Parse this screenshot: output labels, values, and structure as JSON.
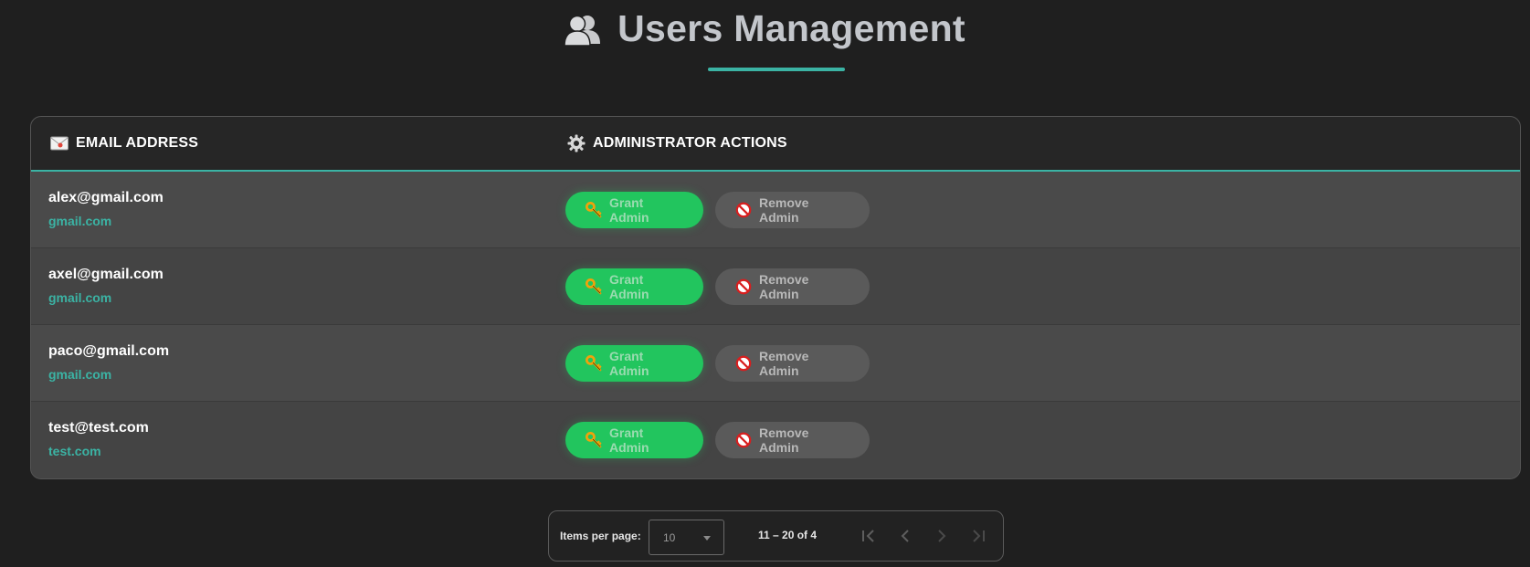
{
  "header": {
    "title": "Users Management",
    "icon": "users-icon",
    "accent": "#3bb3a4"
  },
  "table": {
    "columns": [
      {
        "label": "EMAIL ADDRESS",
        "icon": "envelope-icon"
      },
      {
        "label": "ADMINISTRATOR ACTIONS",
        "icon": "gear-icon"
      }
    ],
    "rows": [
      {
        "email": "alex@gmail.com",
        "domain": "gmail.com"
      },
      {
        "email": "axel@gmail.com",
        "domain": "gmail.com"
      },
      {
        "email": "paco@gmail.com",
        "domain": "gmail.com"
      },
      {
        "email": "test@test.com",
        "domain": "test.com"
      }
    ],
    "grant_label": "Grant Admin",
    "grant_icon": "key-icon",
    "remove_label": "Remove Admin",
    "remove_icon": "no-entry-icon",
    "grant_color": "#22c55e"
  },
  "paginator": {
    "items_per_page_label": "Items per page:",
    "items_per_page_value": "10",
    "range_label": "11 – 20 of 4",
    "nav_icons": [
      "first-page-icon",
      "previous-page-icon",
      "next-page-icon",
      "last-page-icon"
    ]
  }
}
